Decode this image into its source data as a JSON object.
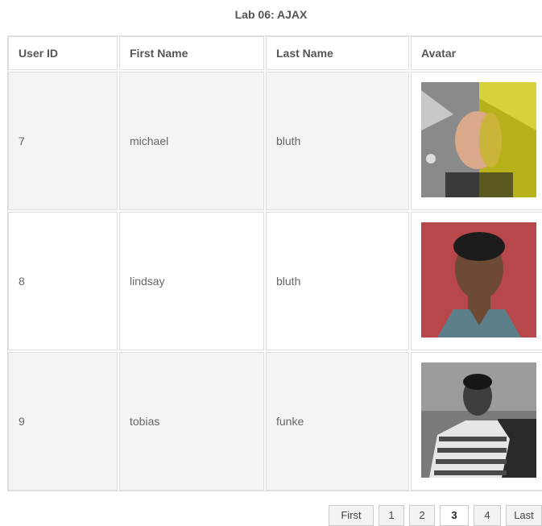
{
  "page": {
    "title": "Lab 06: AJAX"
  },
  "table": {
    "columns": [
      "User ID",
      "First Name",
      "Last Name",
      "Avatar"
    ],
    "rows": [
      {
        "id": "7",
        "first_name": "michael",
        "last_name": "bluth"
      },
      {
        "id": "8",
        "first_name": "lindsay",
        "last_name": "bluth"
      },
      {
        "id": "9",
        "first_name": "tobias",
        "last_name": "funke"
      }
    ]
  },
  "pagination": {
    "first": "First",
    "pages": [
      "1",
      "2",
      "3",
      "4"
    ],
    "current": "3",
    "last": "Last"
  }
}
